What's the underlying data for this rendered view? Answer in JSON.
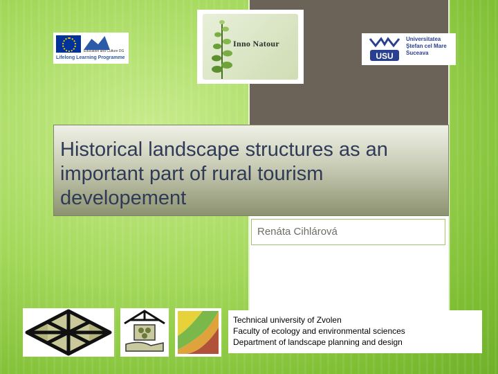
{
  "title": "Historical landscape structures as an important part of rural tourism developement",
  "author": "Renáta Cihlárová",
  "logos": {
    "eu": {
      "program_text": "Lifelong Learning Programme",
      "dg_text": "Education and Culture DG"
    },
    "inno_natour": {
      "text": "Inno Natour"
    },
    "usu": {
      "text": "Universitatea\nŞtefan cel Mare\nSuceava"
    }
  },
  "institution": {
    "line1": "Technical university of Zvolen",
    "line2": "Faculty of ecology and environmental sciences",
    "line3": "Department of landscape planning and design"
  },
  "colors": {
    "background": "#a3d85a",
    "column_dark": "#6b6357",
    "title_text": "#2f3a57",
    "subtitle_text": "#6b6e64"
  }
}
